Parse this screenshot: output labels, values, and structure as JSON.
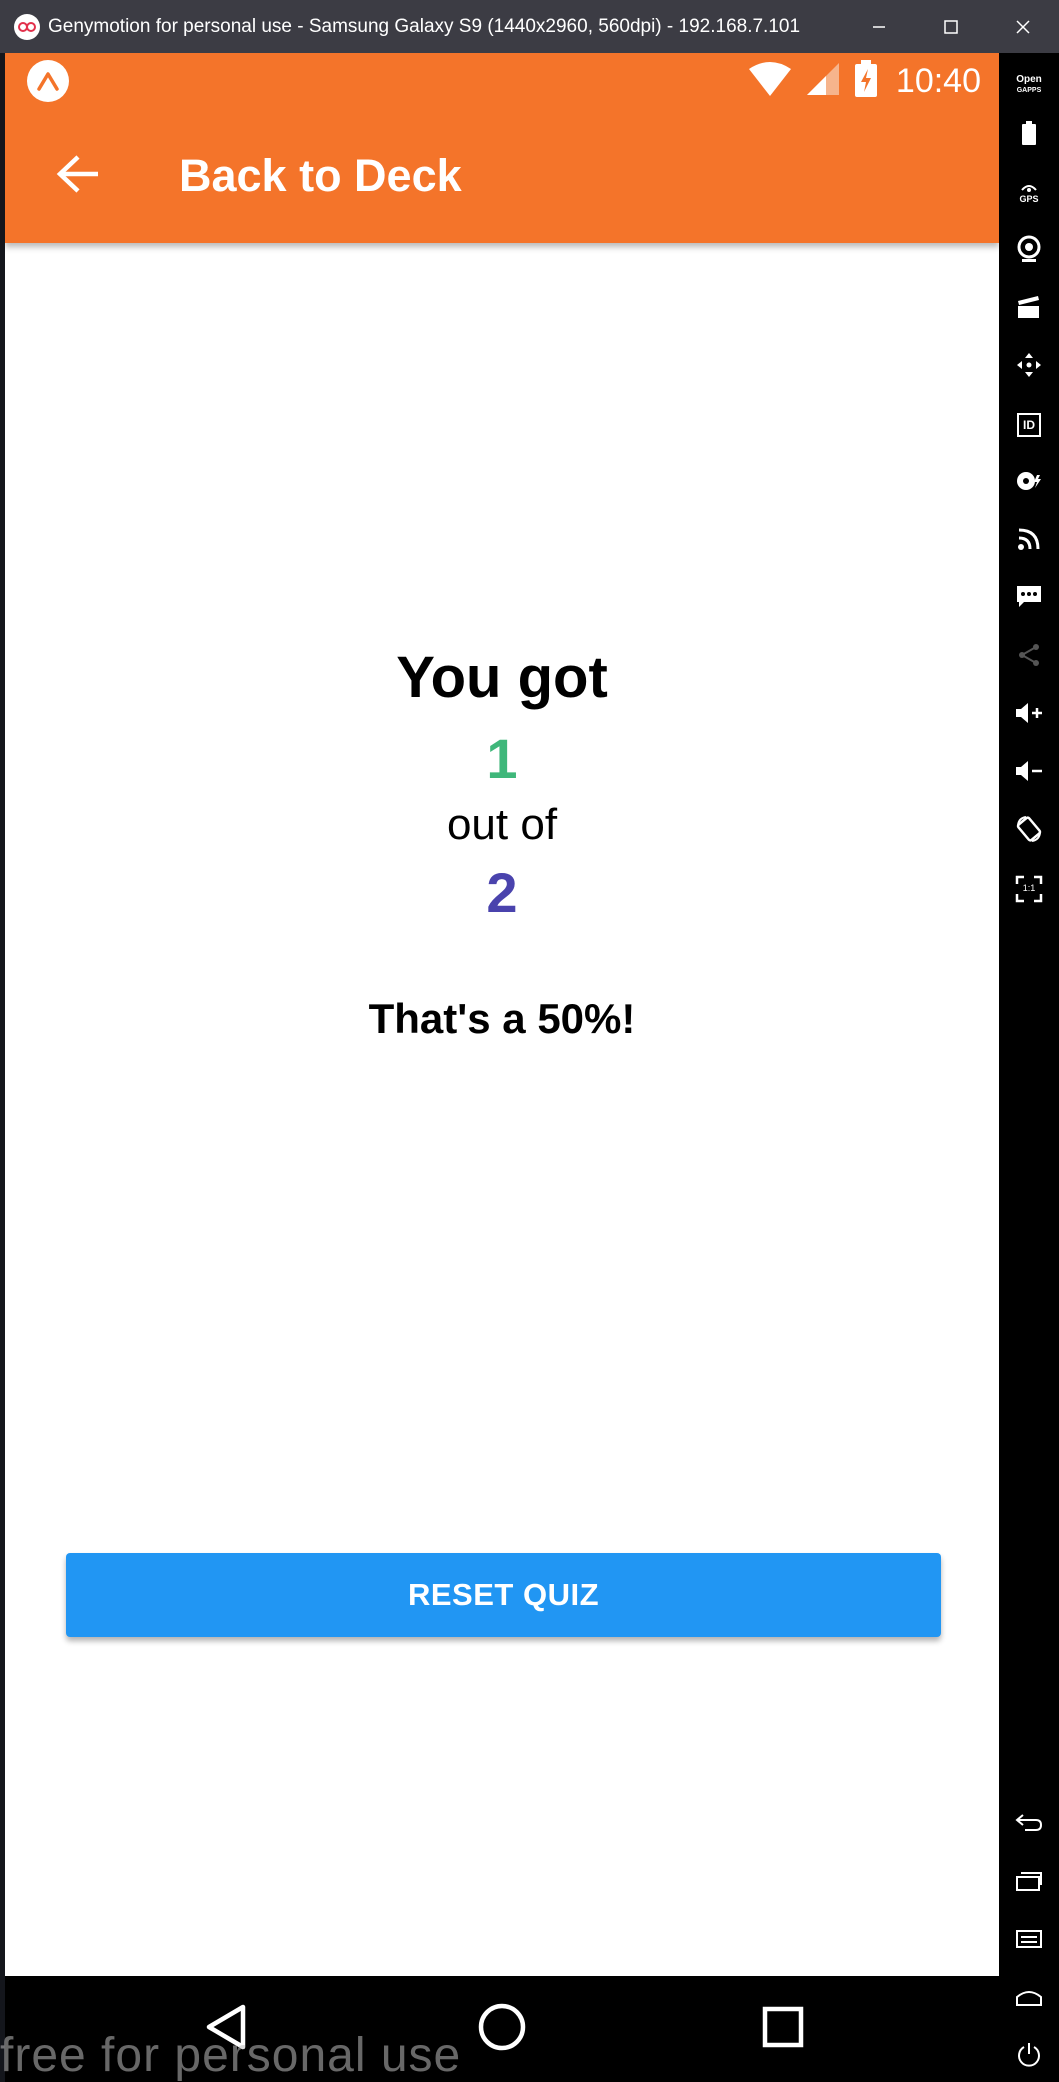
{
  "window": {
    "title": "Genymotion for personal use - Samsung Galaxy S9 (1440x2960, 560dpi) - 192.168.7.101"
  },
  "status_bar": {
    "time": "10:40"
  },
  "app_bar": {
    "title": "Back to Deck"
  },
  "result": {
    "heading": "You got",
    "correct": "1",
    "out_of": "out of",
    "total": "2",
    "percentage_text": "That's a 50%!"
  },
  "actions": {
    "reset_label": "RESET QUIZ"
  },
  "watermark": "free for personal use",
  "side_toolbar": {
    "gapps_label_1": "Open",
    "gapps_label_2": "GAPPS",
    "gps_label": "GPS",
    "id_label": "ID",
    "ratio_label": "1:1"
  },
  "colors": {
    "app_bar": "#f4742a",
    "correct_count": "#3fb77a",
    "total_count": "#4a43ad",
    "primary_button": "#2196f3"
  }
}
